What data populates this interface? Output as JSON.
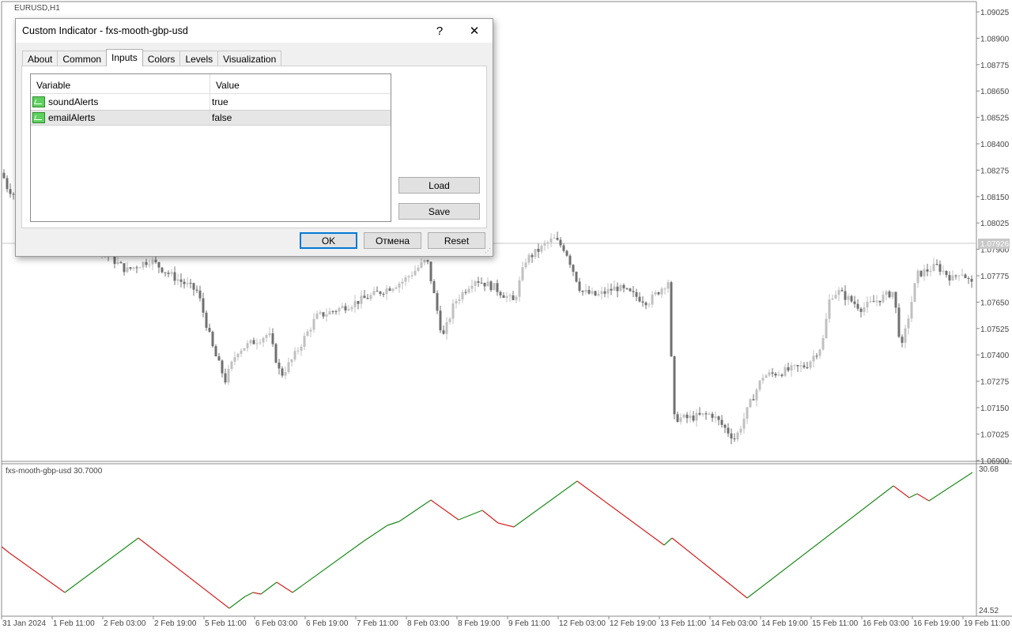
{
  "chart": {
    "symbol_label": "EURUSD,H1",
    "indicator_label": "fxs-mooth-gbp-usd 30.7000",
    "price_axis": [
      "1.09025",
      "1.08900",
      "1.08775",
      "1.08650",
      "1.08525",
      "1.08400",
      "1.08275",
      "1.08150",
      "1.08025",
      "1.07900",
      "1.07775",
      "1.07650",
      "1.07525",
      "1.07400",
      "1.07275",
      "1.07150",
      "1.07025",
      "1.06900"
    ],
    "current_price": "1.07926",
    "indicator_axis_top": "30.68",
    "indicator_axis_bottom": "24.52",
    "time_axis": [
      "31 Jan 2024",
      "1 Feb 11:00",
      "2 Feb 03:00",
      "2 Feb 19:00",
      "5 Feb 11:00",
      "6 Feb 03:00",
      "6 Feb 19:00",
      "7 Feb 11:00",
      "8 Feb 03:00",
      "8 Feb 19:00",
      "9 Feb 11:00",
      "12 Feb 03:00",
      "12 Feb 19:00",
      "13 Feb 11:00",
      "14 Feb 03:00",
      "14 Feb 19:00",
      "15 Feb 11:00",
      "16 Feb 03:00",
      "16 Feb 19:00",
      "19 Feb 11:00"
    ],
    "colors": {
      "up": "#c0c0c0",
      "down": "#707070",
      "ind_up": "#1a8a1a",
      "ind_down": "#d42020"
    }
  },
  "dialog": {
    "title": "Custom Indicator - fxs-mooth-gbp-usd",
    "help": "?",
    "close": "✕",
    "tabs": [
      "About",
      "Common",
      "Inputs",
      "Colors",
      "Levels",
      "Visualization"
    ],
    "active_tab": "Inputs",
    "table": {
      "headers": [
        "Variable",
        "Value"
      ],
      "rows": [
        {
          "variable": "soundAlerts",
          "value": "true"
        },
        {
          "variable": "emailAlerts",
          "value": "false"
        }
      ]
    },
    "load_label": "Load",
    "save_label": "Save",
    "ok_label": "OK",
    "cancel_label": "Отмена",
    "reset_label": "Reset"
  }
}
